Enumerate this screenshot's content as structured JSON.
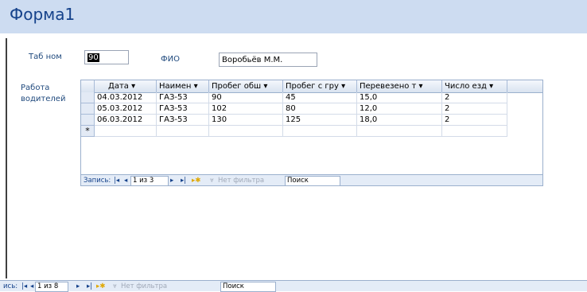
{
  "form": {
    "title": "Форма1"
  },
  "fields": {
    "tab_label": "Таб ном",
    "tab_value": "90",
    "fio_label": "ФИО",
    "fio_value": "Воробьёв М.М.",
    "work_label": "Работа водителей"
  },
  "subgrid": {
    "headers": [
      "Дата",
      "Наимен",
      "Пробег обш",
      "Пробег с гру",
      "Перевезено т",
      "Число езд"
    ],
    "rows": [
      [
        "04.03.2012",
        "ГАЗ-53",
        "90",
        "45",
        "15,0",
        "2"
      ],
      [
        "05.03.2012",
        "ГАЗ-53",
        "102",
        "80",
        "12,0",
        "2"
      ],
      [
        "06.03.2012",
        "ГАЗ-53",
        "130",
        "125",
        "18,0",
        "2"
      ]
    ],
    "new_row_marker": "*",
    "nav": {
      "record_label": "Запись:",
      "position": "1 из 3",
      "filter": "Нет фильтра",
      "search": "Поиск"
    }
  },
  "main_nav": {
    "record_label": "ись:",
    "position": "1 из 8",
    "filter": "Нет фильтра",
    "search": "Поиск"
  }
}
